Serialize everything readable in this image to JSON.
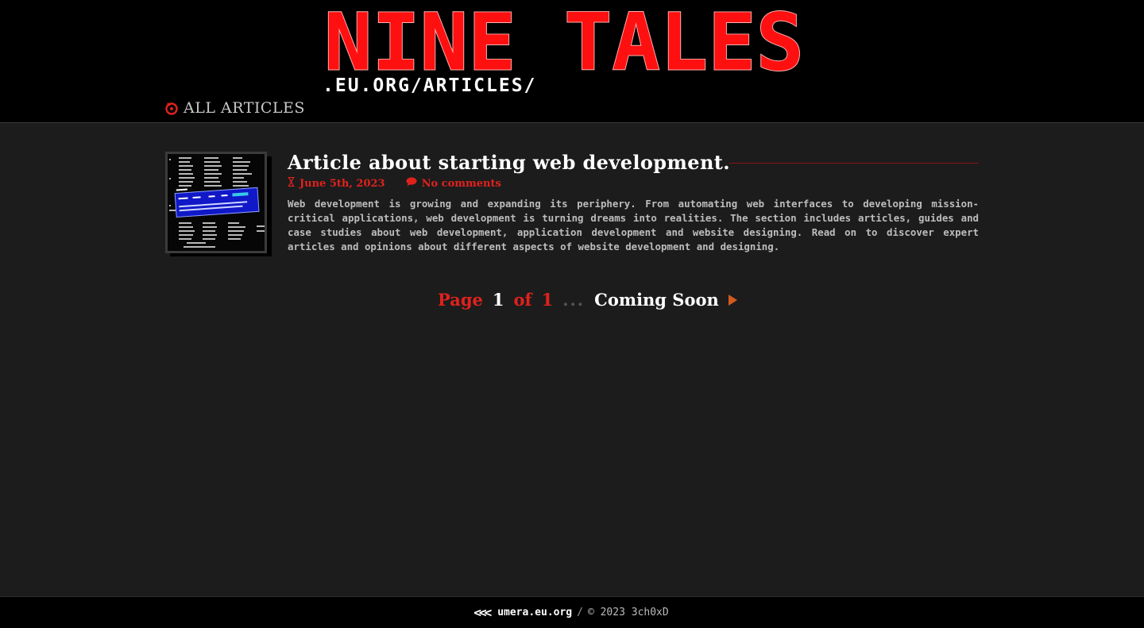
{
  "header": {
    "logo_title": "NINE TALES",
    "logo_subtitle": ".EU.ORG/ARTICLES/",
    "nav": {
      "label": "ALL ARTICLES",
      "icon": "ring-icon"
    }
  },
  "articles": [
    {
      "title": "Article about starting web development.",
      "date": "June 5th, 2023",
      "comments": "No comments",
      "excerpt": "Web development is growing and expanding its periphery. From automating web interfaces to developing mission-critical applications, web development is turning dreams into realities. The section includes articles, guides and case studies about web development, application development and website designing. Read on to discover expert articles and opinions about different aspects of website development and designing."
    }
  ],
  "pagination": {
    "page_word": "Page",
    "current": "1",
    "of_word": "of",
    "total": "1",
    "dots": "...",
    "next_label": "Coming Soon"
  },
  "footer": {
    "site": "umera.eu.org",
    "separator": "/",
    "copyright": "© 2023 3ch0xD"
  },
  "colors": {
    "accent": "#e0221d",
    "background": "#1c1c1c",
    "header_bg": "#000000",
    "arrow": "#d35a1e"
  }
}
